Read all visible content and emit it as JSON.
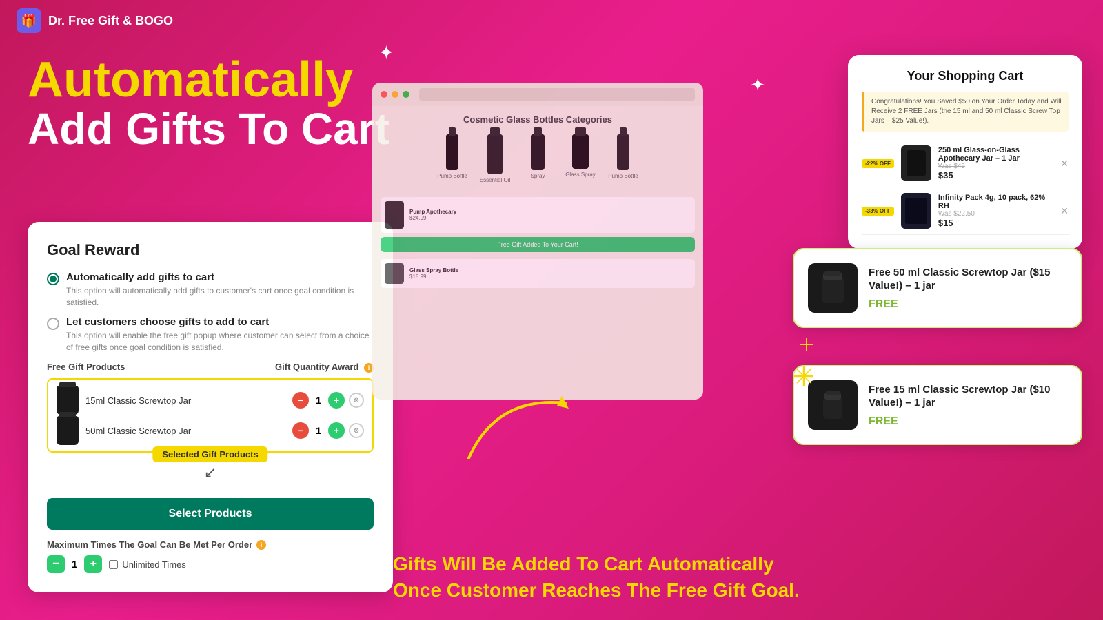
{
  "app": {
    "logo": "🎁",
    "title": "Dr. Free Gift & BOGO"
  },
  "hero": {
    "line1": "Automatically",
    "line2": "Add Gifts To Cart"
  },
  "goalCard": {
    "title": "Goal Reward",
    "option1": {
      "label": "Automatically add gifts to cart",
      "desc": "This option will automatically add gifts to customer's cart once goal condition is satisfied.",
      "selected": true
    },
    "option2": {
      "label": "Let customers choose gifts to add to cart",
      "desc": "This option will enable the free gift popup where customer can select from a choice of free gifts once goal condition is satisfied.",
      "selected": false
    },
    "freeGiftProducts": "Free Gift Products",
    "giftQuantityAward": "Gift Quantity Award",
    "products": [
      {
        "name": "15ml Classic Screwtop Jar",
        "qty": 1
      },
      {
        "name": "50ml Classic Screwtop Jar",
        "qty": 1
      }
    ],
    "selectedBadge": "Selected Gift Products",
    "selectProductsBtn": "Select Products",
    "maxTimesLabel": "Maximum Times The Goal Can Be Met Per Order",
    "maxQty": 1,
    "unlimitedLabel": "Unlimited Times"
  },
  "storePanel": {
    "title": "Cosmetic Glass Bottles Categories",
    "banner": "Free Gift Added To Your Cart!",
    "products": [
      {
        "name": "Pump Bottle"
      },
      {
        "name": "Essential Oil"
      },
      {
        "name": "Spray"
      },
      {
        "name": "Glass Spray"
      },
      {
        "name": "Pump Bottle"
      }
    ]
  },
  "cartPanel": {
    "title": "Your Shopping Cart",
    "congrats": "Congratulations! You Saved $50 on Your Order Today and Will Receive 2 FREE Jars (the 15 ml and 50 ml Classic Screw Top Jars – $25 Value!).",
    "items": [
      {
        "badge": "-22% OFF",
        "name": "250 ml Glass-on-Glass Apothecary Jar – 1 Jar",
        "was": "Was $45",
        "price": "$35"
      },
      {
        "badge": "-33% OFF",
        "name": "Infinity Pack 4g, 10 pack, 62% RH",
        "was": "Was $22.50",
        "price": "$15"
      }
    ]
  },
  "freeGiftCards": [
    {
      "name": "Free 50 ml Classic Screwtop Jar ($15 Value!) – 1 jar",
      "label": "FREE"
    },
    {
      "name": "Free 15 ml Classic Screwtop Jar ($10 Value!) – 1 jar",
      "label": "FREE"
    }
  ],
  "bottomText": {
    "line1": "Gifts Will Be Added To Cart Automatically",
    "line2": "Once Customer Reaches The Free Gift Goal."
  }
}
